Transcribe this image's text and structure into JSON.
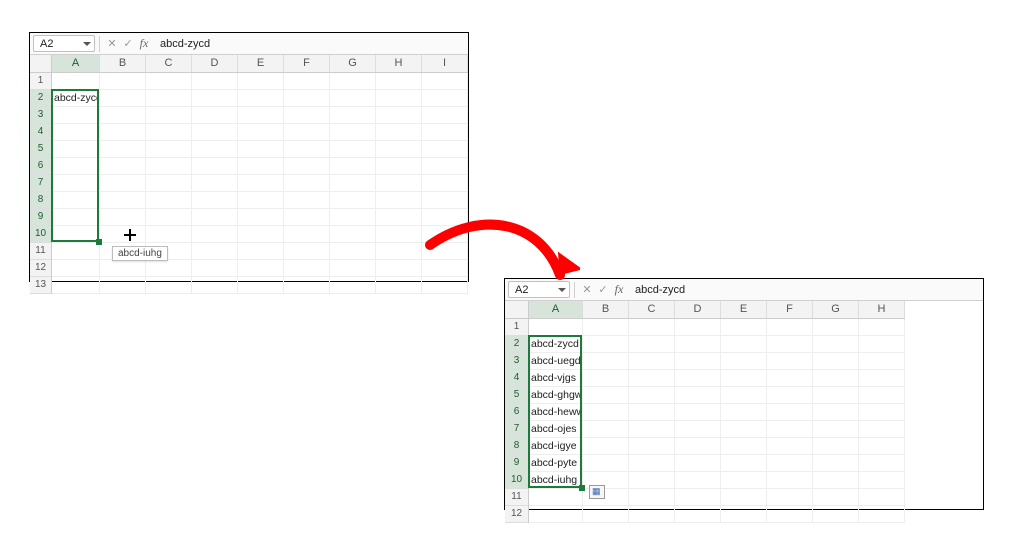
{
  "panel1": {
    "nameBox": "A2",
    "formulaBar": "abcd-zycd",
    "columns": [
      "A",
      "B",
      "C",
      "D",
      "E",
      "F",
      "G",
      "H",
      "I"
    ],
    "rows": [
      "1",
      "2",
      "3",
      "4",
      "5",
      "6",
      "7",
      "8",
      "9",
      "10",
      "11",
      "12",
      "13"
    ],
    "selectedCol": "A",
    "selectedRows": [
      "2",
      "3",
      "4",
      "5",
      "6",
      "7",
      "8",
      "9",
      "10"
    ],
    "cellA2": "abcd-zycd",
    "dragCursorRow": 10,
    "tooltip": "abcd-iuhg"
  },
  "panel2": {
    "nameBox": "A2",
    "formulaBar": "abcd-zycd",
    "columns": [
      "A",
      "B",
      "C",
      "D",
      "E",
      "F",
      "G",
      "H"
    ],
    "rows": [
      "1",
      "2",
      "3",
      "4",
      "5",
      "6",
      "7",
      "8",
      "9",
      "10",
      "11",
      "12"
    ],
    "selectedCol": "A",
    "selectedRows": [
      "2",
      "3",
      "4",
      "5",
      "6",
      "7",
      "8",
      "9",
      "10"
    ],
    "filled": {
      "2": "abcd-zycd",
      "3": "abcd-uegd",
      "4": "abcd-vjgs",
      "5": "abcd-ghgw",
      "6": "abcd-heww",
      "7": "abcd-ojes",
      "8": "abcd-igye",
      "9": "abcd-pyte",
      "10": "abcd-iuhg"
    }
  }
}
